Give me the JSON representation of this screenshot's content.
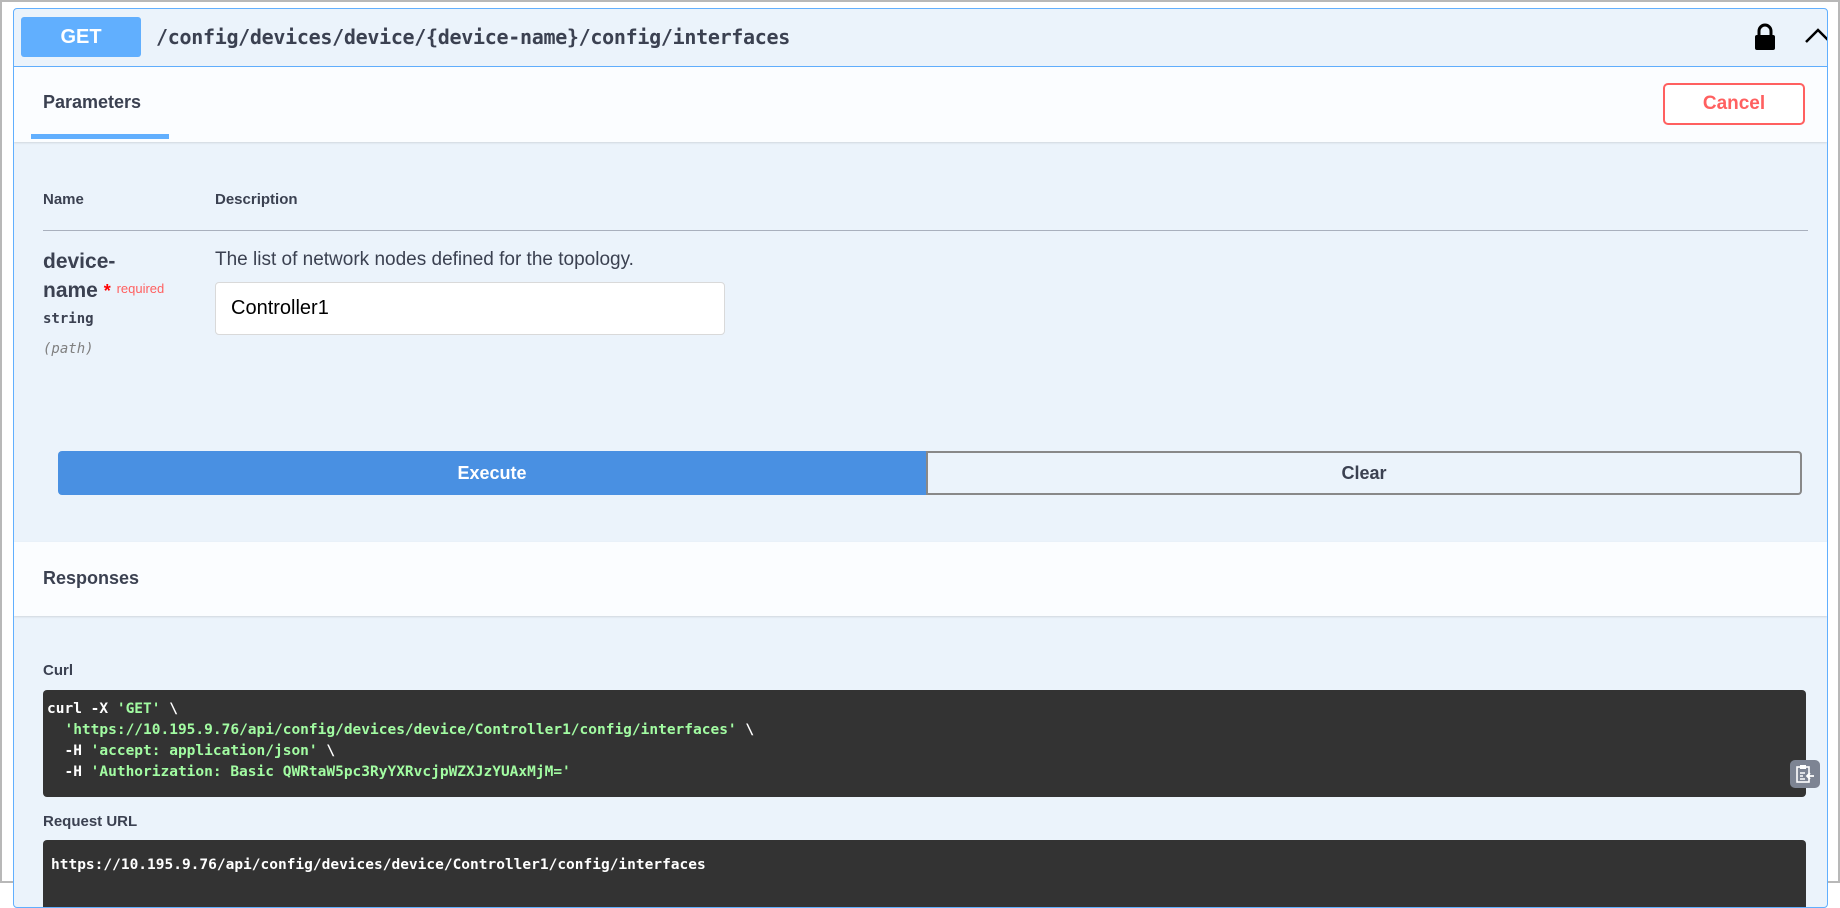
{
  "operation": {
    "method": "GET",
    "path": "/config/devices/device/{device-name}/config/interfaces",
    "colors": {
      "method": "#61affe",
      "cancel": "#ff6060",
      "execute": "#4990e2"
    }
  },
  "tabs": {
    "parameters": "Parameters",
    "cancel": "Cancel"
  },
  "params_table": {
    "headers": {
      "name": "Name",
      "description": "Description"
    },
    "rows": [
      {
        "name_line1": "device-",
        "name_line2": "name",
        "star": "*",
        "required": "required",
        "type": "string",
        "in": "(path)",
        "description": "The list of network nodes defined for the topology.",
        "value": "Controller1"
      }
    ]
  },
  "actions": {
    "execute": "Execute",
    "clear": "Clear"
  },
  "responses": {
    "title": "Responses",
    "curl_label": "Curl",
    "curl": {
      "l1a": "curl -X ",
      "l1b": "'GET'",
      "l1c": " \\",
      "l2a": "  ",
      "l2b": "'https://10.195.9.76/api/config/devices/device/Controller1/config/interfaces'",
      "l2c": " \\",
      "l3a": "  -H ",
      "l3b": "'accept: application/json'",
      "l3c": " \\",
      "l4a": "  -H ",
      "l4b": "'Authorization: Basic QWRtaW5pc3RyYXRvcjpWZXJzYUAxMjM='"
    },
    "request_url_label": "Request URL",
    "request_url": "https://10.195.9.76/api/config/devices/device/Controller1/config/interfaces"
  }
}
